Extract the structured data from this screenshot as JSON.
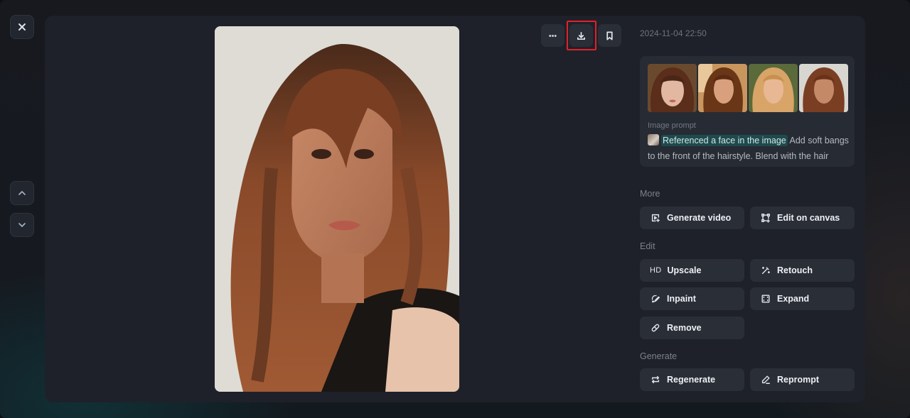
{
  "viewer": {
    "close_label": "Close",
    "prev_label": "Previous",
    "next_label": "Next"
  },
  "toolbar": {
    "more_icon": "more-horizontal-icon",
    "download_icon": "download-icon",
    "bookmark_icon": "bookmark-icon",
    "highlighted": "download"
  },
  "details": {
    "timestamp": "2024-11-04 22:50",
    "reference_images_count": 4,
    "prompt_label": "Image prompt",
    "reference_chip": "Referenced a face in the image",
    "prompt_text": "Add soft bangs to the front of the hairstyle. Blend with the hair"
  },
  "sections": {
    "more": {
      "label": "More",
      "buttons": [
        {
          "label": "Generate video",
          "icon": "video-add-icon"
        },
        {
          "label": "Edit on canvas",
          "icon": "canvas-icon"
        }
      ]
    },
    "edit": {
      "label": "Edit",
      "buttons": [
        {
          "label": "Upscale",
          "icon": "HD"
        },
        {
          "label": "Retouch",
          "icon": "magic-wand-icon"
        },
        {
          "label": "Inpaint",
          "icon": "inpaint-brush-icon"
        },
        {
          "label": "Expand",
          "icon": "expand-icon"
        },
        {
          "label": "Remove",
          "icon": "eraser-icon"
        }
      ]
    },
    "generate": {
      "label": "Generate",
      "buttons": [
        {
          "label": "Regenerate",
          "icon": "repeat-icon"
        },
        {
          "label": "Reprompt",
          "icon": "pencil-icon"
        }
      ]
    }
  },
  "colors": {
    "highlight": "#e3202a",
    "chip_bg": "#1f4a4d",
    "panel_bg": "#1e2129",
    "button_bg": "#2a2e37"
  }
}
